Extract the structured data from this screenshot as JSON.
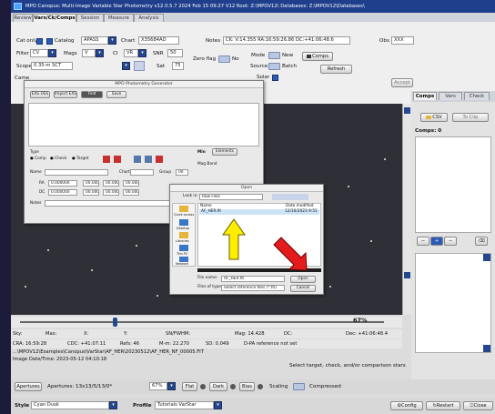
{
  "window": {
    "title": "MPO Canopus: Multi-Image Variable Star Photometry v12.0.5.7 2024 Feb 15 09:27 V12 Root: Z:\\MPOV12\\ Databases: Z:\\MPOV12\\Databases\\"
  },
  "tabs": [
    {
      "label": "Review"
    },
    {
      "label": "Vars/Ck/Comps"
    },
    {
      "label": "Session"
    },
    {
      "label": "Measure"
    },
    {
      "label": "Analysis"
    }
  ],
  "controls": {
    "cat_only_label": "Cat only",
    "catalog_label": "Catalog",
    "catalog_value": "APASS",
    "chart_label": "Chart",
    "chart_value": "X35684AD",
    "notes_label": "Notes",
    "notes_value": "CK: V:14.355 RA:16:59:26.86 DC:+41:06:48.6",
    "obs_label": "Obs",
    "obs_value": "XXX",
    "filter_label": "Filter",
    "filter_value": "CV",
    "mags_label": "Mags",
    "mags_value": "V",
    "ci_label": "CI",
    "ci_value": "VR",
    "snr_label": "SNR",
    "snr_value": "50",
    "zero_flag_label": "Zero flag",
    "zero_flag_value": "No",
    "mode_label": "Mode",
    "mode_value": "New",
    "comps_button": "Comps",
    "scope_label": "Scope",
    "scope_value": "0.35-m SCT",
    "sat_label": "Sat",
    "sat_value": "75",
    "source_label": "Source",
    "source_value": "Batch",
    "solar_label": "Solar",
    "refresh_button": "Refresh",
    "accept_button": "Accept",
    "camera_label": "Came"
  },
  "photometry_dialog": {
    "title": "MPO Photometry Generator",
    "buttons": [
      "EXS DSS",
      "Import EXS",
      "Find",
      "Save"
    ],
    "type_label": "Type",
    "type_options": [
      "Comp",
      "Check",
      "Target"
    ],
    "min_label": "Min",
    "elements_label": "Elements",
    "mag_band_label": "Mag Band",
    "name_label": "Name",
    "chart_label": "Chart",
    "group_label": "Group",
    "group_value": "00",
    "ra_label": "RA",
    "ra_value": "0.000000",
    "dc_label": "DC",
    "dc_value": "0.000000",
    "coord_values": [
      "00.000",
      "00.000",
      "00.000"
    ],
    "notes_label": "Notes"
  },
  "open_dialog": {
    "title": "Open",
    "look_in_label": "Look in:",
    "look_in_value": "Raw Files",
    "columns": [
      "Name",
      "Date modified"
    ],
    "file_name": "AF_HER.fit",
    "file_date": "12/10/2023 9:51",
    "places": [
      "Quick access",
      "Desktop",
      "Libraries",
      "This PC",
      "Network"
    ],
    "file_name_label": "File name:",
    "file_name_value": "AF_HER.fit",
    "file_type_label": "Files of type:",
    "file_type_value": "Select reference files (*.fit)",
    "open_button": "Open",
    "cancel_button": "Cancel"
  },
  "right_panel": {
    "tabs": [
      "Comps",
      "Vars",
      "Check"
    ],
    "csv_button": "CSV",
    "to_clipboard_button": "To Clip",
    "comps_count": "Comps: 0"
  },
  "zoom": "67%",
  "readout": {
    "sky_label": "Sky:",
    "max_label": "Max:",
    "x_label": "X:",
    "y_label": "Y:",
    "snfwhm_label": "SN/FWHM:",
    "mag_text": "Mag: 14.428",
    "dc_label": "DC:",
    "dec_text": "Dec: +41:06:48.4",
    "cra_text": "CRA: 16:59:28",
    "cdc_text": "CDC: +41:07:11",
    "refs_text": "Refs: 46",
    "mrm_text": "M-m: 22.270",
    "sd_text": "SD: 0.049",
    "dpa_text": "D-PA reference not set"
  },
  "file_path": "...\\MPOV12\\Examples\\Canopus\\VarStar\\AF_HER\\20230512\\AF_HER_NF_00005.FIT",
  "image_datetime": "Image Date/Time: 2023-05-12 04:10:18",
  "hint": "Select target, check, and/or comparison stars",
  "bottom": {
    "apertures_button": "Apertures",
    "apertures_text": "Apertures: 13x13/5/13/0*",
    "zoom_value": "67%",
    "flat_button": "Flat",
    "dark_button": "Dark",
    "bias_button": "Bias",
    "scaling_label": "Scaling",
    "compressed_label": "Compressed",
    "style_label": "Style",
    "style_value": "Cyan Dusk",
    "profile_label": "Profile",
    "profile_value": "Tutorials VarStar",
    "config_button": "Config",
    "restart_button": "Restart",
    "close_button": "Close"
  },
  "accent_colors": {
    "title_bar": "#1f3f8c",
    "highlight_arrow_yellow": "#ffee00",
    "highlight_arrow_red": "#e51c1c"
  }
}
